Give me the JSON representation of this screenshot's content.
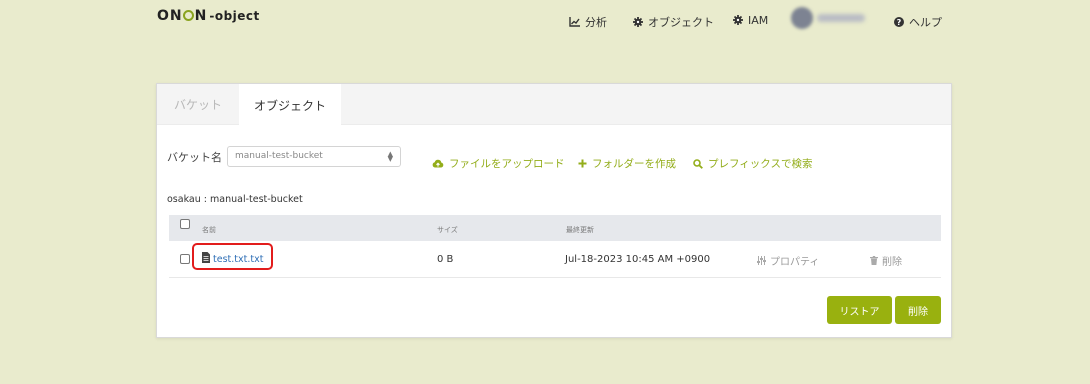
{
  "app": {
    "logo": {
      "part1": "ON",
      "part2": "I",
      "part3": "N",
      "suffix": "-object"
    }
  },
  "nav": {
    "analytics": {
      "label": "分析",
      "icon": "chart-line-icon"
    },
    "objects": {
      "label": "オブジェクト",
      "icon": "gear-icon"
    },
    "iam": {
      "label": "IAM",
      "icon": "gear-icon"
    },
    "help": {
      "label": "ヘルプ",
      "icon": "question-circle-icon"
    }
  },
  "tabs": [
    {
      "label": "バケット",
      "active": false
    },
    {
      "label": "オブジェクト",
      "active": true
    }
  ],
  "toolbar": {
    "bucket_label": "バケット名",
    "bucket_value": "manual-test-bucket",
    "upload": "ファイルをアップロード",
    "create_folder": "フォルダーを作成",
    "search_prefix": "プレフィックスで検索"
  },
  "path": "osakau : manual-test-bucket",
  "table": {
    "headers": {
      "name": "名前",
      "size": "サイズ",
      "modified": "最終更新"
    },
    "rows": [
      {
        "name": "test.txt.txt",
        "size": "0 B",
        "modified": "Jul-18-2023 10:45 AM +0900",
        "properties": "プロパティ",
        "delete": "削除"
      }
    ]
  },
  "buttons": {
    "restore": "リストア",
    "delete": "削除"
  },
  "colors": {
    "background": "#e9ebcd",
    "accent": "#99b10f",
    "link": "#2f6fb6",
    "highlight": "#e21c1c"
  }
}
